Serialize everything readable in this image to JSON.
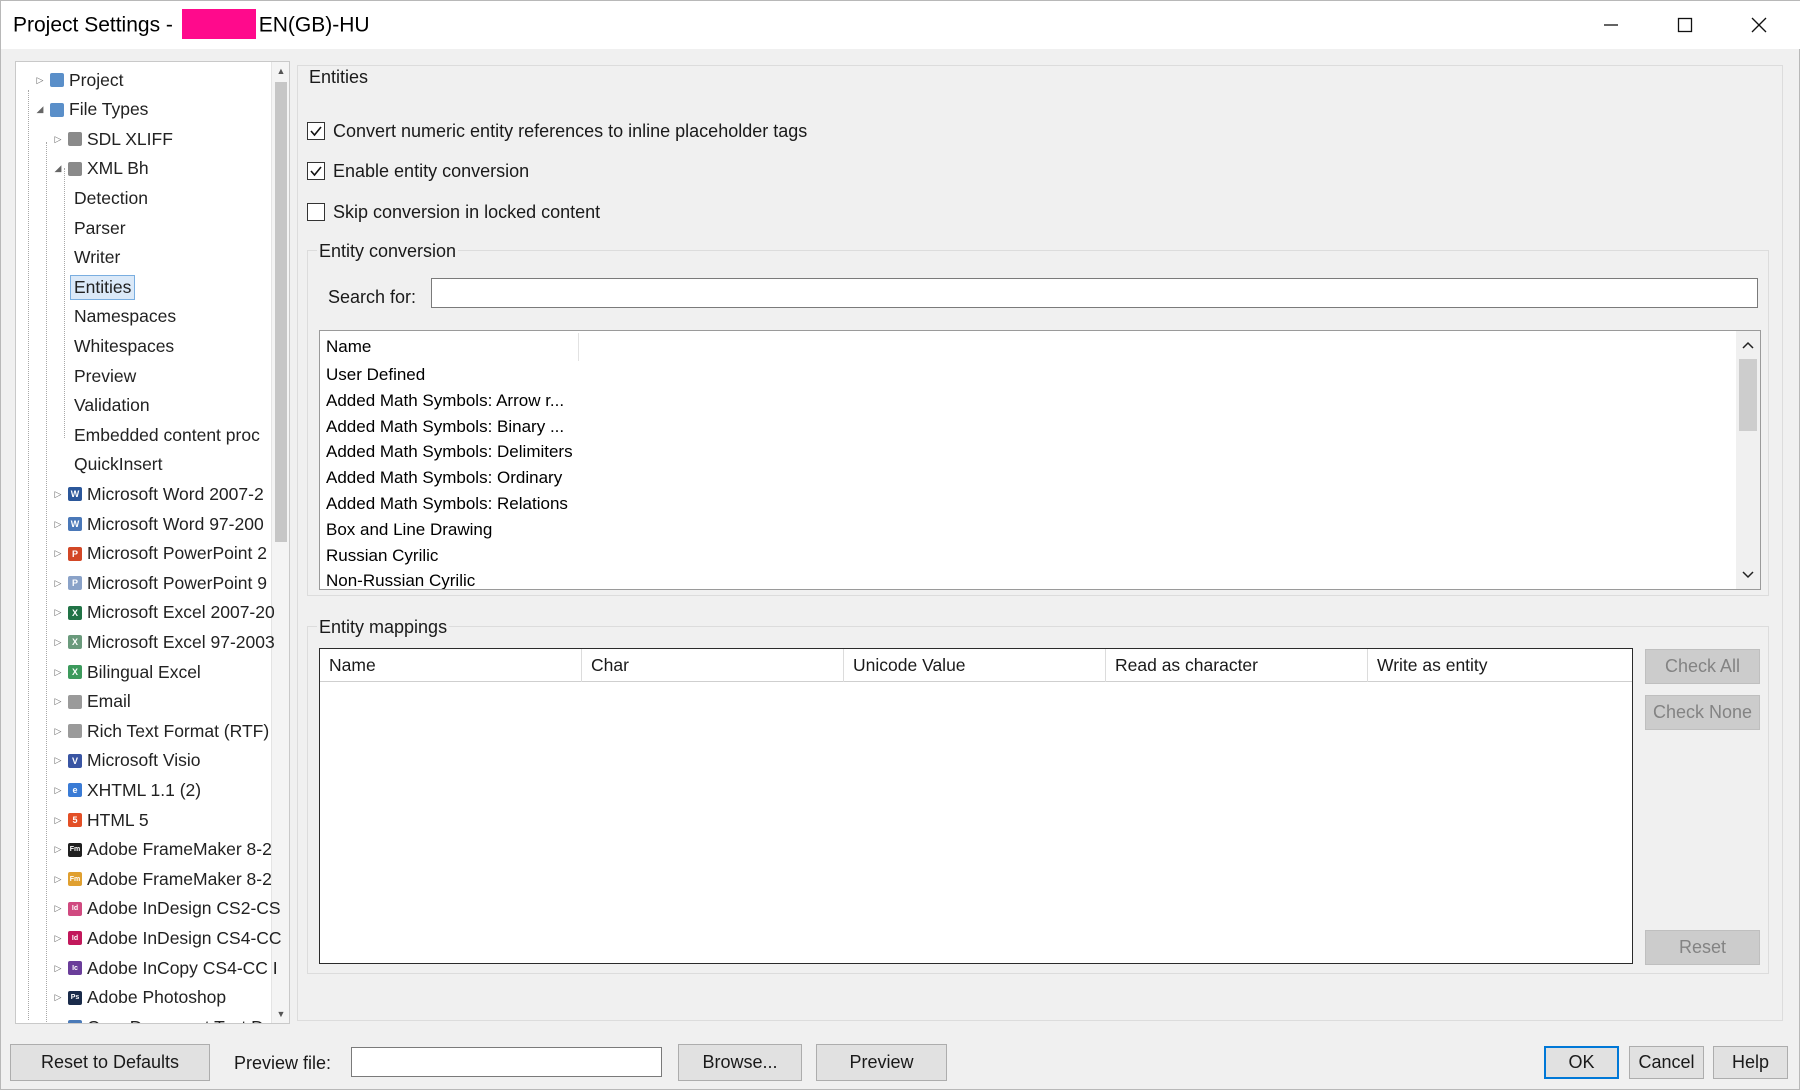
{
  "window": {
    "title_prefix": "Project Settings - ",
    "title_suffix": "EN(GB)-HU"
  },
  "tree": {
    "items": [
      {
        "label": "Project",
        "icon": "project-icon",
        "color": "#5a8fc9"
      },
      {
        "label": "File Types",
        "icon": "file-types-icon",
        "color": "#5a8fc9"
      },
      {
        "label": "SDL XLIFF",
        "icon": "document-icon",
        "color": "#8a8a8a"
      },
      {
        "label": "XML Bh",
        "icon": "xml-file-icon",
        "color": "#8a8a8a"
      },
      {
        "label": "Detection"
      },
      {
        "label": "Parser"
      },
      {
        "label": "Writer"
      },
      {
        "label": "Entities",
        "selected": true
      },
      {
        "label": "Namespaces"
      },
      {
        "label": "Whitespaces"
      },
      {
        "label": "Preview"
      },
      {
        "label": "Validation"
      },
      {
        "label": "Embedded content proc"
      },
      {
        "label": "QuickInsert"
      },
      {
        "label": "Microsoft Word 2007-2",
        "icon": "word-icon",
        "color": "#2b579a",
        "glyph": "W"
      },
      {
        "label": "Microsoft Word 97-200",
        "icon": "word-icon",
        "color": "#4a78b8",
        "glyph": "W"
      },
      {
        "label": "Microsoft PowerPoint 2",
        "icon": "powerpoint-icon",
        "color": "#d24726",
        "glyph": "P"
      },
      {
        "label": "Microsoft PowerPoint 9",
        "icon": "powerpoint-icon",
        "color": "#8aa2c8",
        "glyph": "P"
      },
      {
        "label": "Microsoft Excel 2007-20",
        "icon": "excel-icon",
        "color": "#217346",
        "glyph": "X"
      },
      {
        "label": "Microsoft Excel 97-2003",
        "icon": "excel-icon",
        "color": "#6a9a7c",
        "glyph": "X"
      },
      {
        "label": "Bilingual Excel",
        "icon": "excel-icon",
        "color": "#3c9a5c",
        "glyph": "X"
      },
      {
        "label": "Email",
        "icon": "email-icon",
        "color": "#9a9a9a"
      },
      {
        "label": "Rich Text Format (RTF)",
        "icon": "rtf-icon",
        "color": "#9a9a9a"
      },
      {
        "label": "Microsoft Visio",
        "icon": "visio-icon",
        "color": "#3955a3",
        "glyph": "V"
      },
      {
        "label": "XHTML 1.1 (2)",
        "icon": "xhtml-icon",
        "color": "#3a7bd5",
        "glyph": "e"
      },
      {
        "label": "HTML 5",
        "icon": "html5-icon",
        "color": "#e34f26",
        "glyph": "5"
      },
      {
        "label": "Adobe FrameMaker 8-2",
        "icon": "framemaker-icon",
        "color": "#1f1f1f",
        "glyph": "Fm"
      },
      {
        "label": "Adobe FrameMaker 8-2",
        "icon": "framemaker-icon",
        "color": "#e0a030",
        "glyph": "Fm"
      },
      {
        "label": "Adobe InDesign CS2-CS",
        "icon": "indesign-icon",
        "color": "#d04a80",
        "glyph": "Id"
      },
      {
        "label": "Adobe InDesign CS4-CC",
        "icon": "indesign-icon",
        "color": "#c2185b",
        "glyph": "Id"
      },
      {
        "label": "Adobe InCopy CS4-CC I",
        "icon": "incopy-icon",
        "color": "#6a3d9a",
        "glyph": "Ic"
      },
      {
        "label": "Adobe Photoshop",
        "icon": "photoshop-icon",
        "color": "#1a2b4a",
        "glyph": "Ps"
      },
      {
        "label": "OpenDocument Text D",
        "icon": "document-icon",
        "color": "#4a7ab8"
      }
    ]
  },
  "entities": {
    "group_title": "Entities",
    "checkboxes": [
      {
        "label": "Convert numeric entity references to inline placeholder tags",
        "checked": true
      },
      {
        "label": "Enable entity conversion",
        "checked": true
      },
      {
        "label": "Skip conversion in locked content",
        "checked": false
      }
    ]
  },
  "entity_conversion": {
    "group_title": "Entity conversion",
    "search_label": "Search for:",
    "search_value": "",
    "list_header": "Name",
    "items": [
      "User Defined",
      "Added Math Symbols: Arrow r...",
      "Added Math Symbols: Binary ...",
      "Added Math Symbols: Delimiters",
      "Added Math Symbols: Ordinary",
      "Added Math Symbols: Relations",
      "Box and Line Drawing",
      "Russian Cyrilic",
      "Non-Russian Cyrilic"
    ]
  },
  "entity_mappings": {
    "group_title": "Entity mappings",
    "columns": [
      "Name",
      "Char",
      "Unicode Value",
      "Read as character",
      "Write as entity"
    ],
    "rows": [],
    "check_all": "Check All",
    "check_none": "Check None",
    "reset": "Reset"
  },
  "footer": {
    "reset_defaults": "Reset to Defaults",
    "preview_file_label": "Preview file:",
    "preview_file_value": "",
    "browse": "Browse...",
    "preview": "Preview",
    "ok": "OK",
    "cancel": "Cancel",
    "help": "Help"
  },
  "colors": {
    "accent": "#0078d7",
    "redaction": "#ff0a8c",
    "selection": "#dbe9f8"
  }
}
